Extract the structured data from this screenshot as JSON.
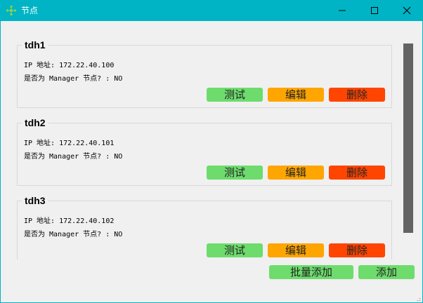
{
  "window": {
    "title": "节点",
    "icon": "tree-node-icon",
    "controls": [
      "minimize-icon",
      "maximize-icon",
      "close-icon"
    ]
  },
  "nodes": [
    {
      "name": "tdh1",
      "ip_line": "IP 地址: 172.22.40.100",
      "manager_line": "是否为 Manager 节点? : NO"
    },
    {
      "name": "tdh2",
      "ip_line": "IP 地址: 172.22.40.101",
      "manager_line": "是否为 Manager 节点? : NO"
    },
    {
      "name": "tdh3",
      "ip_line": "IP 地址: 172.22.40.102",
      "manager_line": "是否为 Manager 节点? : NO"
    }
  ],
  "buttons": {
    "test": "测试",
    "edit": "编辑",
    "delete": "删除"
  },
  "footer": {
    "batch_add": "批量添加",
    "add": "添加"
  },
  "colors": {
    "titlebar": "#00b4c5",
    "test": "#6ddc6d",
    "edit": "#ffa500",
    "delete": "#ff4500",
    "scrollbar": "#636363"
  }
}
